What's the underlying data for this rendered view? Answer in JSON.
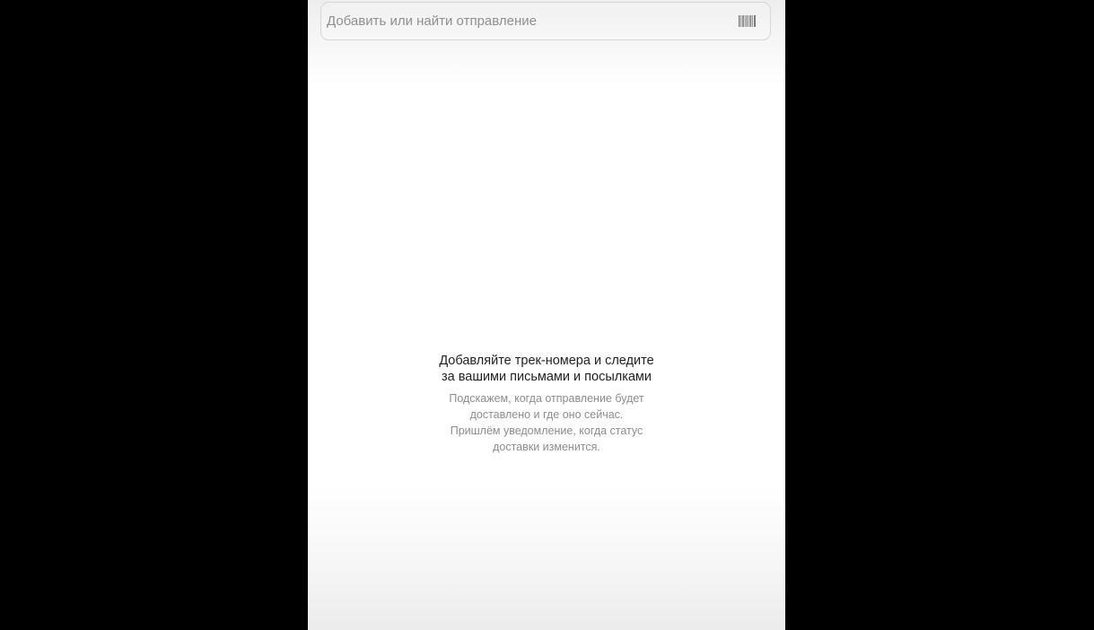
{
  "search": {
    "placeholder": "Добавить или найти отправление",
    "value": "",
    "scan_icon": "barcode-icon"
  },
  "empty_state": {
    "title_line1": "Добавляйте трек-номера и следите",
    "title_line2": "за вашими письмами и посылками",
    "desc_line1": "Подскажем, когда отправление будет",
    "desc_line2": "доставлено и где оно сейчас.",
    "desc_line3": "Пришлём уведомление, когда статус",
    "desc_line4": "доставки изменится."
  },
  "colors": {
    "background_outer": "#000000",
    "screen_background": "#ffffff",
    "title_text": "#1f1f1f",
    "secondary_text": "#8c8c8c",
    "placeholder_text": "#8f8f8f"
  }
}
